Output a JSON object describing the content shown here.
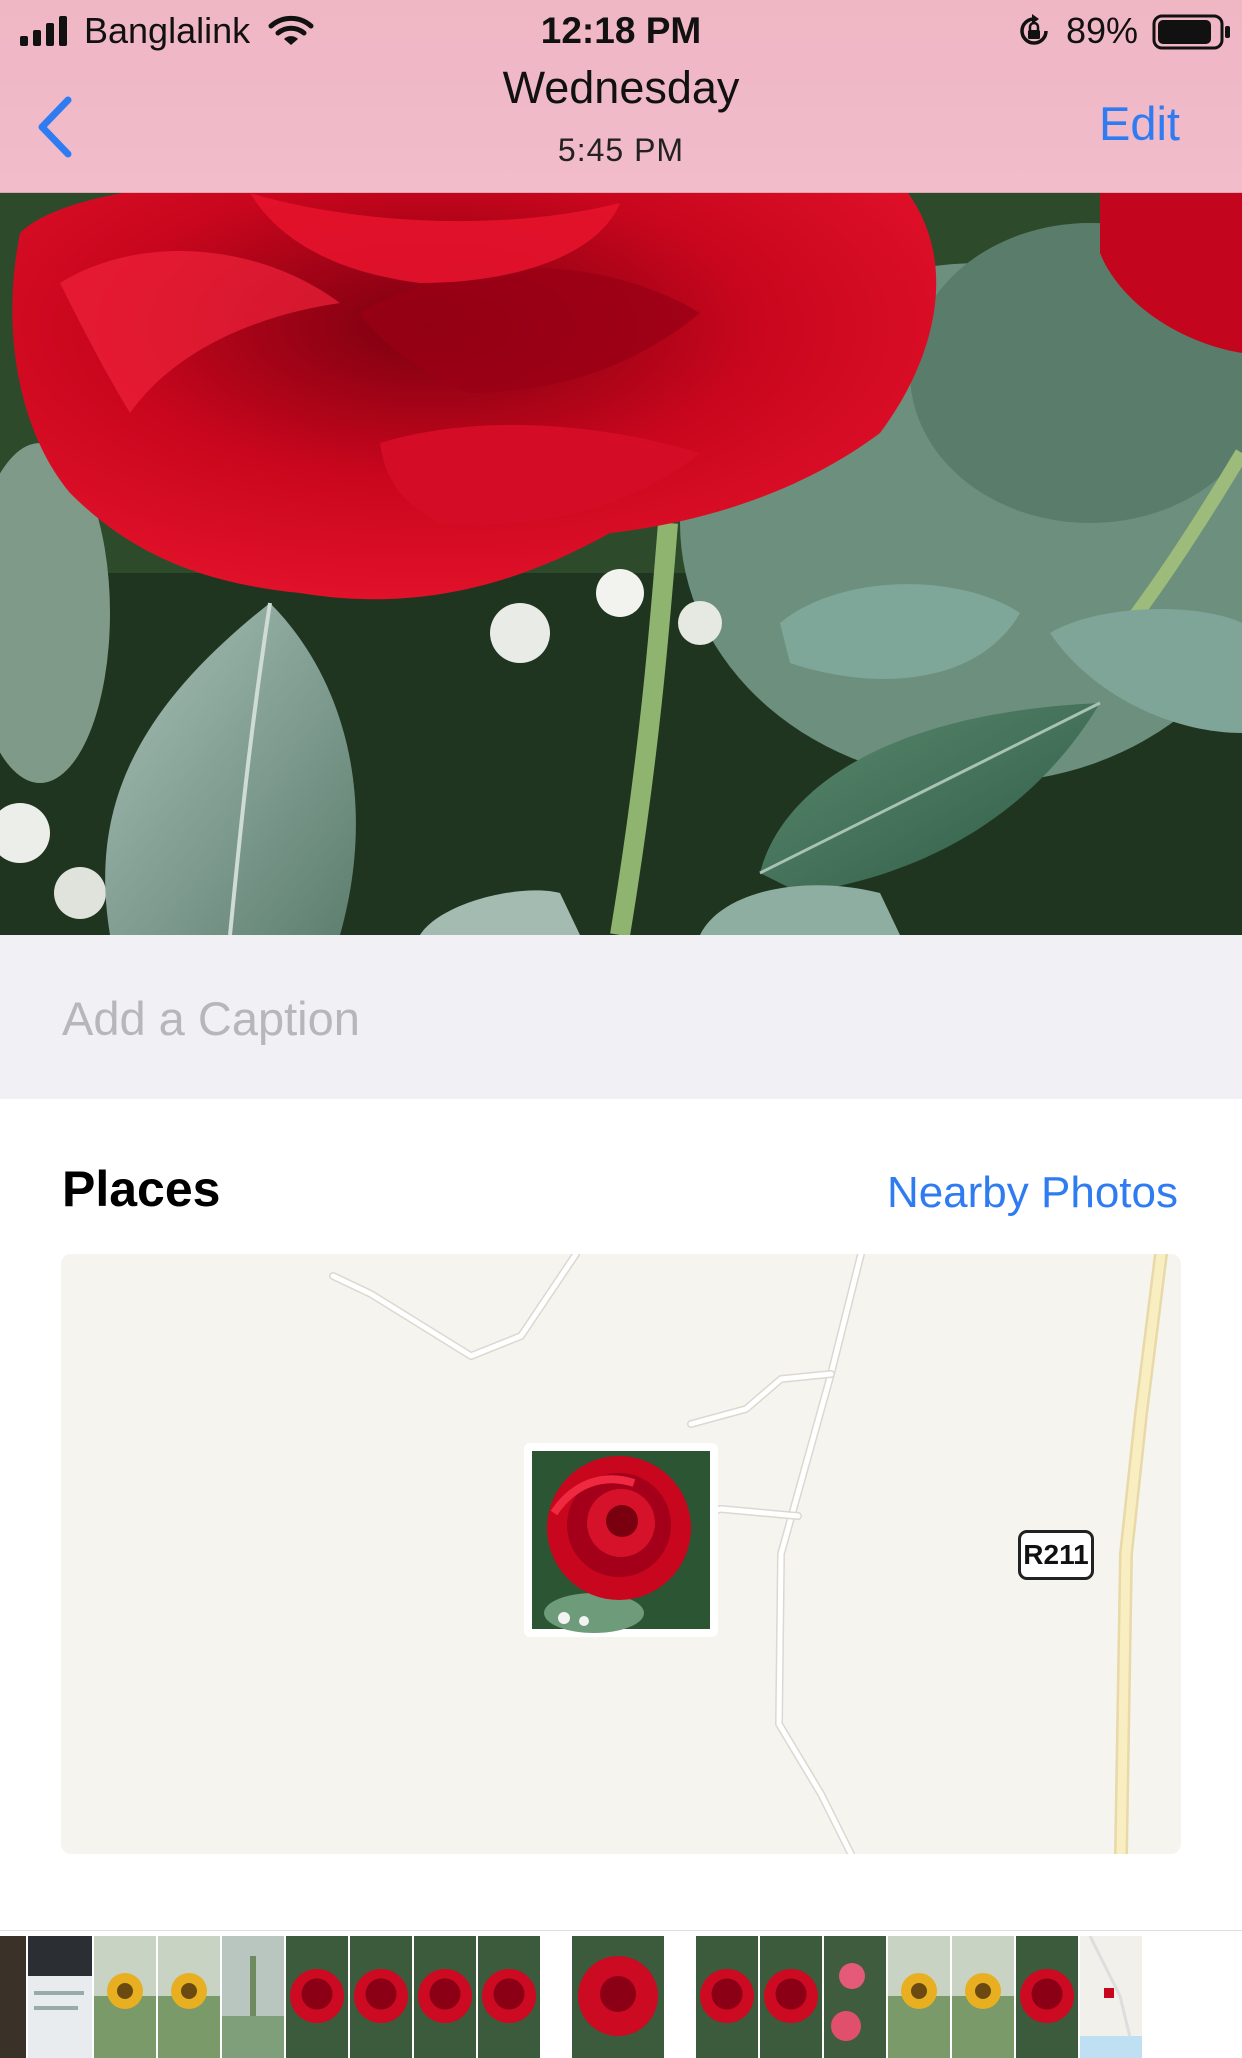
{
  "status_bar": {
    "carrier": "Banglalink",
    "time": "12:18 PM",
    "battery_percent": "89%",
    "battery_level": 0.89
  },
  "nav": {
    "title": "Wednesday",
    "subtitle": "5:45 PM",
    "edit_label": "Edit"
  },
  "caption": {
    "placeholder": "Add a Caption"
  },
  "places": {
    "title": "Places",
    "nearby_label": "Nearby Photos",
    "road_label": "R211"
  },
  "colors": {
    "accent": "#2f7cf2",
    "header": "#f0b7c6"
  }
}
